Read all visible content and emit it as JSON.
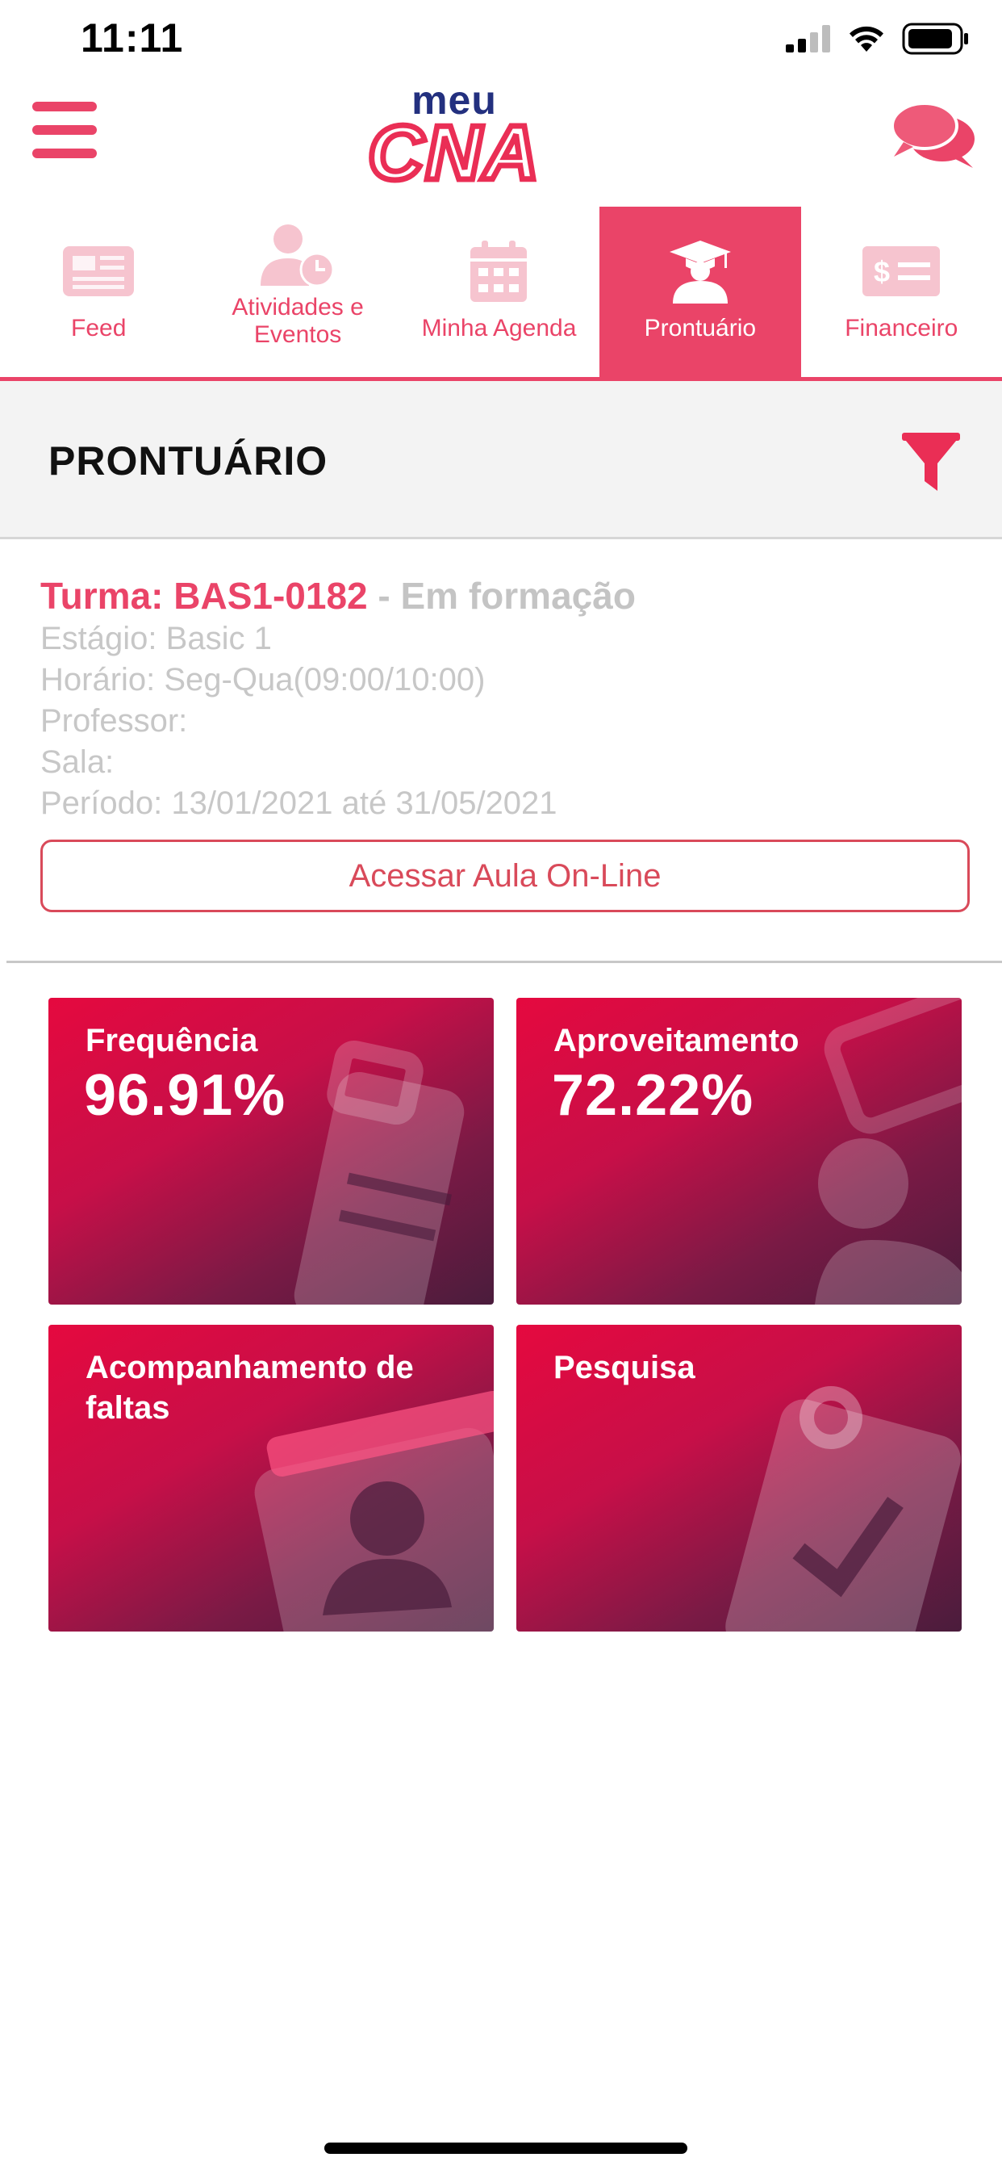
{
  "status_bar": {
    "time": "11:11"
  },
  "header": {
    "logo_top": "meu",
    "logo_bottom": "CNA"
  },
  "tabs": [
    {
      "label": "Feed",
      "icon": "newspaper-icon",
      "active": false
    },
    {
      "label": "Atividades e Eventos",
      "icon": "user-clock-icon",
      "active": false
    },
    {
      "label": "Minha Agenda",
      "icon": "calendar-icon",
      "active": false
    },
    {
      "label": "Prontuário",
      "icon": "graduate-icon",
      "active": true
    },
    {
      "label": "Financeiro",
      "icon": "money-bill-icon",
      "active": false
    }
  ],
  "section": {
    "title": "PRONTUÁRIO"
  },
  "class_info": {
    "title_prefix": "Turma: BAS1-0182",
    "title_status": " - Em formação",
    "stage": "Estágio: Basic 1",
    "schedule": "Horário: Seg-Qua(09:00/10:00)",
    "teacher": "Professor:",
    "room": "Sala:",
    "period": "Período: 13/01/2021 até 31/05/2021",
    "online_button": "Acessar Aula On-Line"
  },
  "cards": [
    {
      "title": "Frequência",
      "value": "96.91%"
    },
    {
      "title": "Aproveitamento",
      "value": "72.22%"
    },
    {
      "title": "Acompanhamento de faltas",
      "value": ""
    },
    {
      "title": "Pesquisa",
      "value": ""
    }
  ],
  "colors": {
    "accent": "#ea4468",
    "brand_blue": "#23307f",
    "muted_text": "#c7c7c7"
  }
}
